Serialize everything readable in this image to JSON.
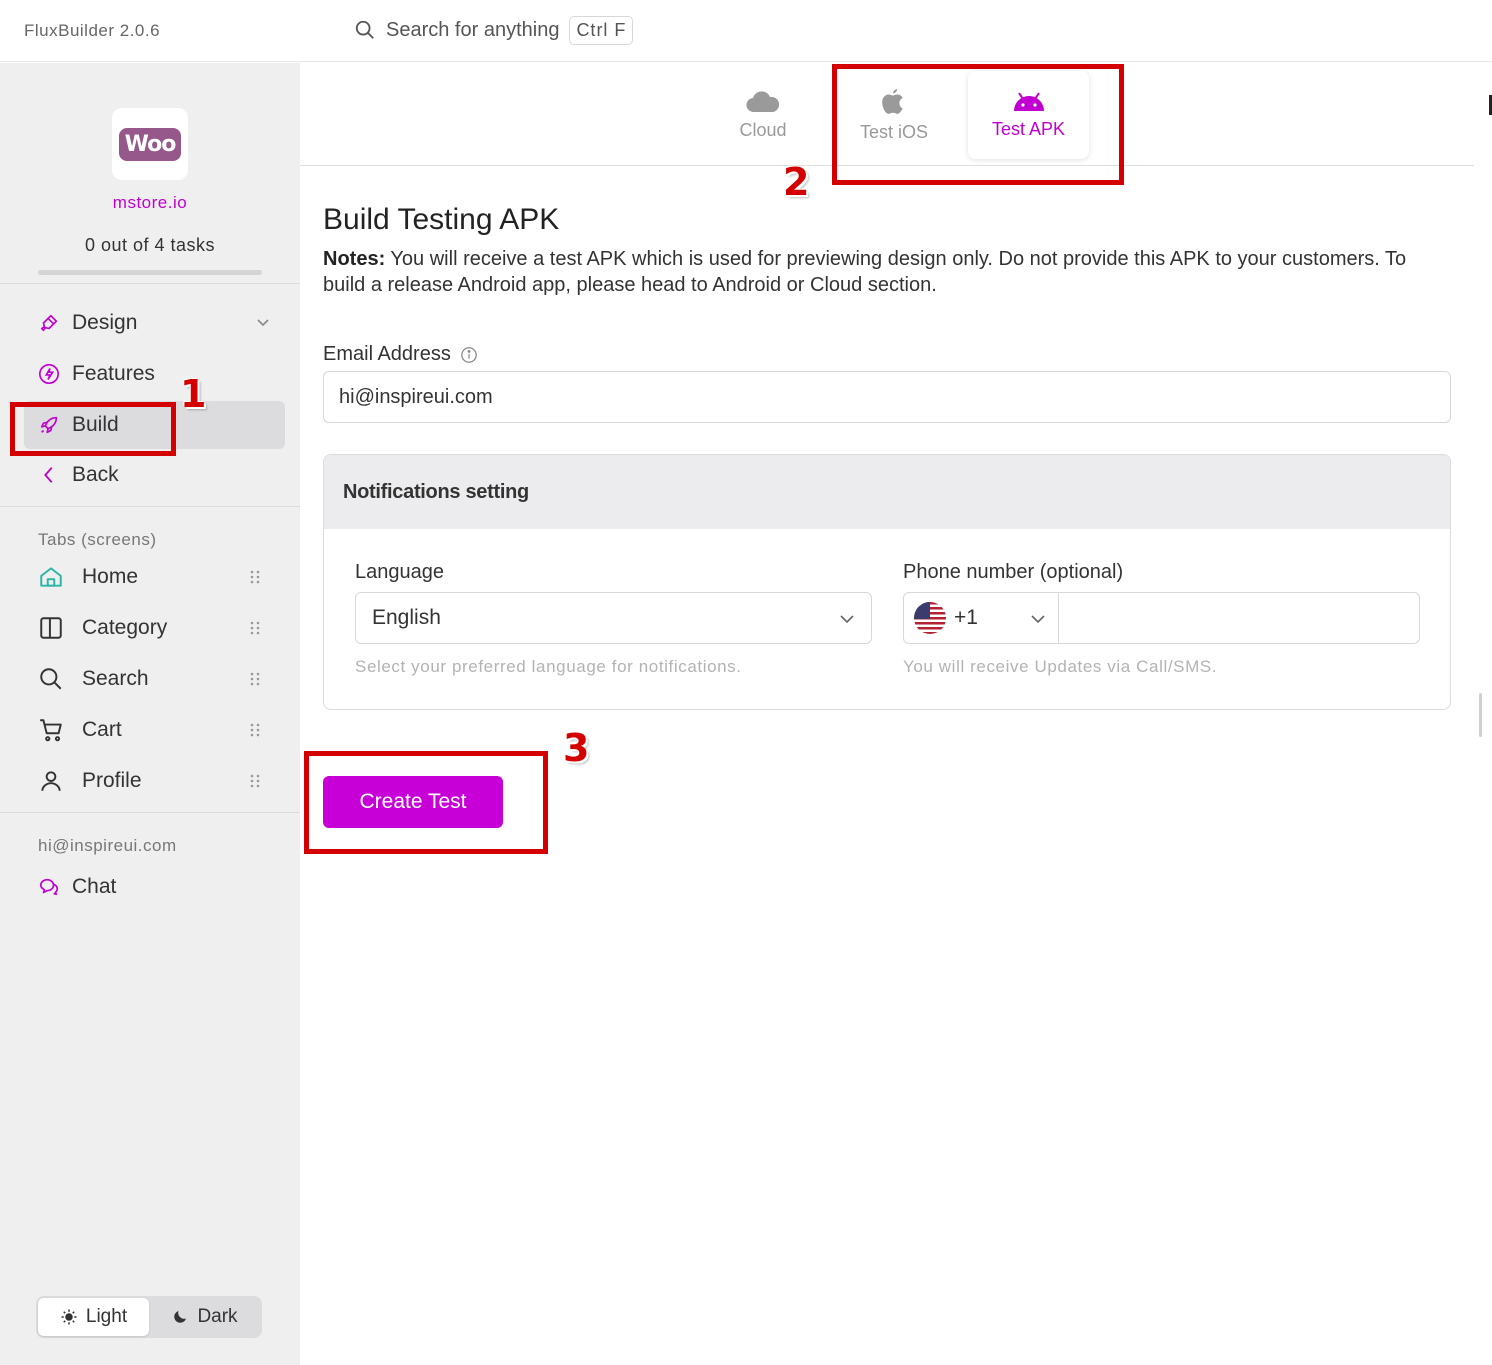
{
  "app": {
    "title": "FluxBuilder 2.0.6"
  },
  "search": {
    "placeholder": "Search for anything",
    "shortcut": "Ctrl F"
  },
  "sidebar": {
    "store": {
      "logo_text": "Woo",
      "name": "mstore.io"
    },
    "tasks_label": "0 out of 4 tasks",
    "tasks_progress": 0,
    "nav": [
      {
        "label": "Design",
        "icon": "brush-icon"
      },
      {
        "label": "Features",
        "icon": "bolt-icon"
      },
      {
        "label": "Build",
        "icon": "rocket-icon"
      },
      {
        "label": "Back",
        "icon": "chevron-left-icon"
      }
    ],
    "tabs_section_label": "Tabs (screens)",
    "tabs": [
      {
        "label": "Home",
        "icon": "home-icon"
      },
      {
        "label": "Category",
        "icon": "columns-icon"
      },
      {
        "label": "Search",
        "icon": "search-icon"
      },
      {
        "label": "Cart",
        "icon": "cart-icon"
      },
      {
        "label": "Profile",
        "icon": "user-icon"
      }
    ],
    "account_email": "hi@inspireui.com",
    "chat_label": "Chat",
    "theme": {
      "light": "Light",
      "dark": "Dark",
      "selected": "Light"
    }
  },
  "build_tabs": [
    {
      "label": "Cloud",
      "icon": "cloud-icon"
    },
    {
      "label": "Test iOS",
      "icon": "apple-icon"
    },
    {
      "label": "Test APK",
      "icon": "android-icon",
      "active": true
    }
  ],
  "main": {
    "heading": "Build Testing APK",
    "notes_label": "Notes:",
    "notes_text": " You will receive a test APK which is used for previewing design only. Do not provide this APK to your customers. To build a release Android app, please head to Android or Cloud section.",
    "email_label": "Email Address",
    "email_value": "hi@inspireui.com",
    "notifications": {
      "title": "Notifications setting",
      "language_label": "Language",
      "language_value": "English",
      "language_help": "Select your preferred language for notifications.",
      "phone_label": "Phone number (optional)",
      "phone_code": "+1",
      "phone_value": "",
      "phone_help": "You will receive Updates via Call/SMS."
    },
    "create_button": "Create Test"
  },
  "annotations": {
    "step1": "1",
    "step2": "2",
    "step3": "3",
    "color": "#d40000"
  },
  "colors": {
    "accent": "#c000d0",
    "button": "#c800d8",
    "sidebar_bg": "#efeff0"
  }
}
